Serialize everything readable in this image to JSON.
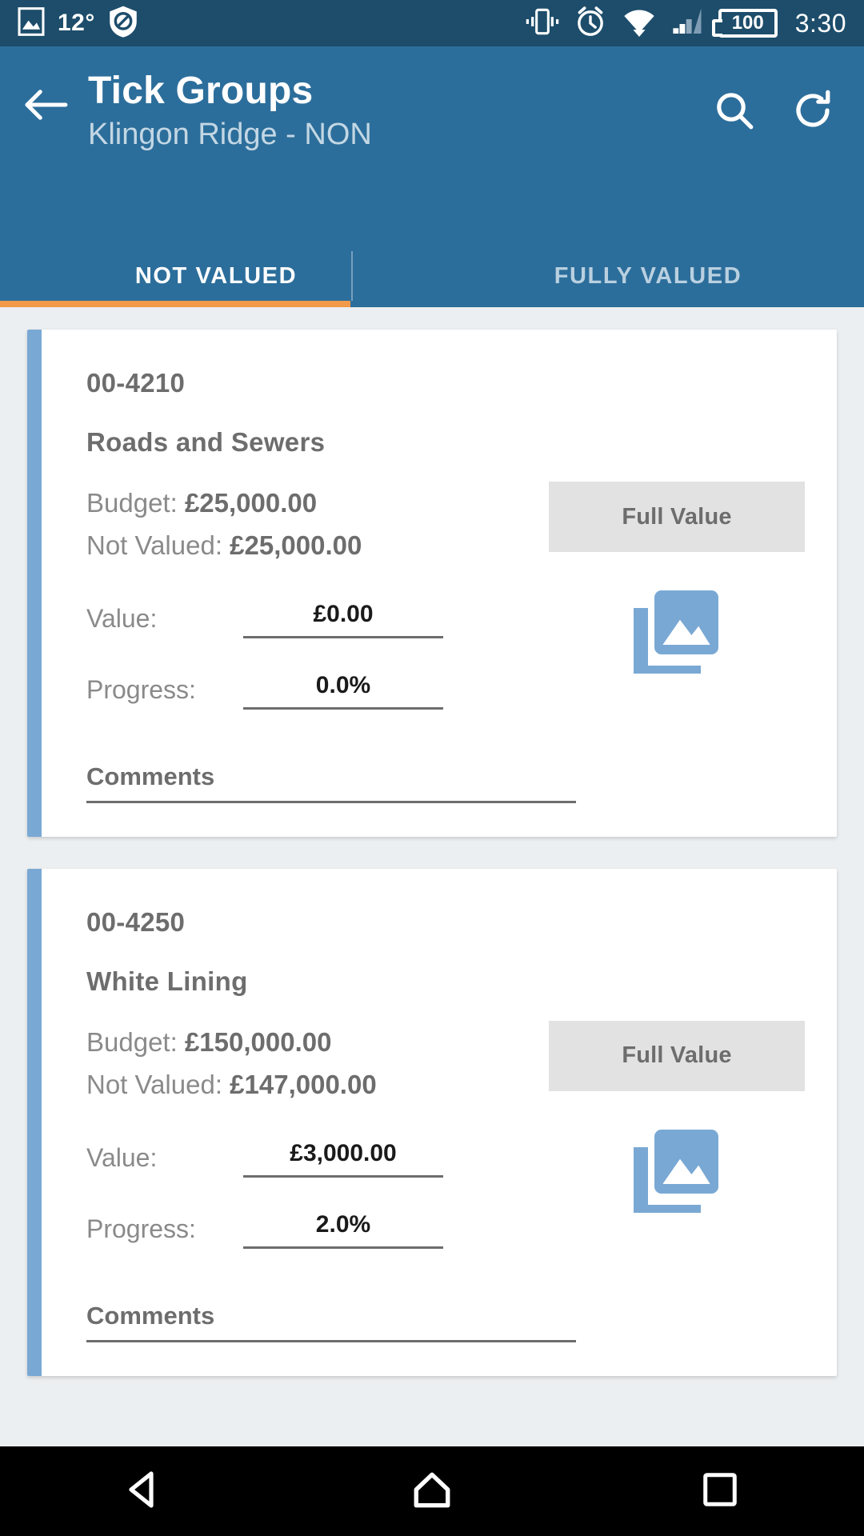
{
  "statusbar": {
    "photo_icon": "image-icon",
    "temperature": "12°",
    "shield_icon": "blocked-shield-icon",
    "vibrate_icon": "vibrate-icon",
    "alarm_icon": "alarm-clock-icon",
    "wifi_icon": "wifi-icon",
    "signal_icon": "cellular-signal-icon",
    "battery_level": "100",
    "time": "3:30"
  },
  "appbar": {
    "back_icon": "back-arrow-icon",
    "title": "Tick Groups",
    "subtitle": "Klingon Ridge - NON",
    "search_icon": "search-icon",
    "refresh_icon": "refresh-icon",
    "background": "#2c6e9b"
  },
  "tabs": {
    "items": [
      {
        "label": "NOT VALUED",
        "active": true
      },
      {
        "label": "FULLY VALUED",
        "active": false
      }
    ],
    "indicator_color": "#f2994a"
  },
  "cards": [
    {
      "code": "00-4210",
      "name": "Roads and Sewers",
      "budget_label": "Budget:",
      "budget_value": "£25,000.00",
      "notvalued_label": "Not Valued:",
      "notvalued_value": "£25,000.00",
      "value_label": "Value:",
      "value_amount": "£0.00",
      "progress_label": "Progress:",
      "progress_amount": "0.0%",
      "full_value_label": "Full Value",
      "gallery_icon": "photo-gallery-icon",
      "comments_label": "Comments",
      "accent_color": "#7aa8d4"
    },
    {
      "code": "00-4250",
      "name": "White Lining",
      "budget_label": "Budget:",
      "budget_value": "£150,000.00",
      "notvalued_label": "Not Valued:",
      "notvalued_value": "£147,000.00",
      "value_label": "Value:",
      "value_amount": "£3,000.00",
      "progress_label": "Progress:",
      "progress_amount": "2.0%",
      "full_value_label": "Full Value",
      "gallery_icon": "photo-gallery-icon",
      "comments_label": "Comments",
      "accent_color": "#7aa8d4"
    }
  ],
  "navbar": {
    "back_icon": "nav-back-triangle-icon",
    "home_icon": "nav-home-icon",
    "recents_icon": "nav-recents-square-icon"
  }
}
